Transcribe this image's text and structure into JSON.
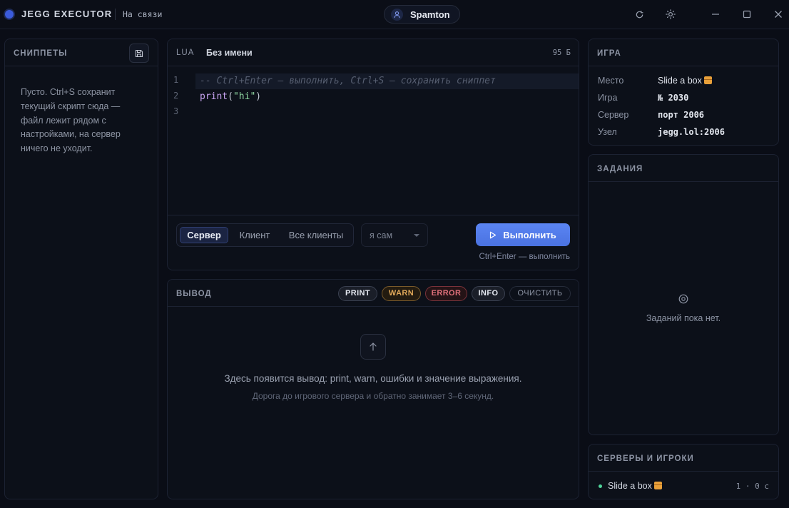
{
  "titlebar": {
    "app_name": "JEGG EXECUTOR",
    "status": "На связи",
    "user": "Spamton"
  },
  "snippets": {
    "title": "СНИППЕТЫ",
    "empty_text": "Пусто. Ctrl+S сохранит текущий скрипт сюда — файл лежит рядом с настройками, на сервер ничего не уходит."
  },
  "editor": {
    "language": "LUA",
    "file_name": "Без имени",
    "size": "95 Б",
    "line_numbers": [
      "1",
      "2",
      "3"
    ],
    "comment_line": "-- Ctrl+Enter — выполнить, Ctrl+S — сохранить сниппет",
    "code_fn": "print",
    "code_open": "(",
    "code_str": "\"hi\"",
    "code_close": ")",
    "targets": [
      "Сервер",
      "Клиент",
      "Все клиенты"
    ],
    "active_target": "Сервер",
    "player_select": "я сам",
    "run_label": "Выполнить",
    "run_hint": "Ctrl+Enter — выполнить"
  },
  "output": {
    "title": "ВЫВОД",
    "filters": [
      "PRINT",
      "WARN",
      "ERROR",
      "INFO"
    ],
    "clear_label": "ОЧИСТИТЬ",
    "empty_main": "Здесь появится вывод: print, warn, ошибки и значение выражения.",
    "empty_sub": "Дорога до игрового сервера и обратно занимает 3–6 секунд."
  },
  "game": {
    "title": "ИГРА",
    "rows": [
      {
        "key": "Место",
        "value": "Slide a box"
      },
      {
        "key": "Игра",
        "value": "№ 2030"
      },
      {
        "key": "Сервер",
        "value": "порт 2006"
      },
      {
        "key": "Узел",
        "value": "jegg.lol:2006"
      }
    ]
  },
  "tasks": {
    "title": "ЗАДАНИЯ",
    "empty": "Заданий пока нет."
  },
  "servers": {
    "title": "СЕРВЕРЫ И ИГРОКИ",
    "items": [
      {
        "name": "Slide a box",
        "meta": "1 · 0 с"
      }
    ]
  },
  "colors": {
    "accent": "#4f7cf0",
    "online": "#4fd49a",
    "warn": "#e0a85a",
    "error": "#e0707a"
  }
}
